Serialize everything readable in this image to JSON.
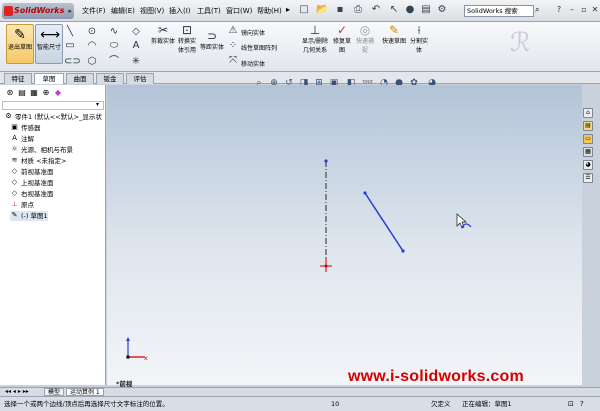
{
  "app": {
    "logo_text": "SolidWorks"
  },
  "menu": [
    {
      "label": "文件(F)"
    },
    {
      "label": "编辑(E)"
    },
    {
      "label": "视图(V)"
    },
    {
      "label": "插入(I)"
    },
    {
      "label": "工具(T)"
    },
    {
      "label": "窗口(W)"
    },
    {
      "label": "帮助(H)"
    }
  ],
  "search": {
    "placeholder": "SolidWorks 搜索"
  },
  "commands": {
    "exit_sketch": "退出草图",
    "smart_dimension": "智能尺寸",
    "trim": "剪裁实体",
    "convert": "转换实体引用",
    "offset": "等距实体",
    "mirror": "镜向实体",
    "linear_pattern": "线性草图阵列",
    "move": "移动实体",
    "display_relations": "显示/删除几何关系",
    "repair": "修复草图",
    "quick_snaps": "快速捕捉",
    "rapid_sketch": "快速草图",
    "instant2d": "分割实体"
  },
  "tabs": [
    {
      "label": "特征"
    },
    {
      "label": "草图"
    },
    {
      "label": "曲面"
    },
    {
      "label": "钣金"
    },
    {
      "label": "评估"
    }
  ],
  "feature_tree": [
    {
      "icon": "part-icon",
      "label": "零件1 (默认<<默认>_显示状"
    },
    {
      "icon": "sensor-icon",
      "label": "传感器"
    },
    {
      "icon": "annotation-icon",
      "label": "注解"
    },
    {
      "icon": "lights-icon",
      "label": "光源、相机与布景"
    },
    {
      "icon": "material-icon",
      "label": "材质 <未指定>"
    },
    {
      "icon": "plane-icon",
      "label": "前视基准面"
    },
    {
      "icon": "plane-icon",
      "label": "上视基准面"
    },
    {
      "icon": "plane-icon",
      "label": "右视基准面"
    },
    {
      "icon": "origin-icon",
      "label": "原点"
    },
    {
      "icon": "sketch-icon",
      "label": "(-) 草图1"
    }
  ],
  "view_label": "*前视",
  "watermark": "www.i-solidworks.com",
  "bottom_tabs": [
    {
      "label": "模型"
    },
    {
      "label": "运动算例 1"
    }
  ],
  "status": {
    "hint": "选择一个或两个边线/顶点后再选择尺寸文字标注的位置。",
    "value": "10",
    "state": "欠定义",
    "editing": "正在编辑：草图1"
  },
  "colors": {
    "sketch_line": "#2a3fd0",
    "centerline": "#2b2b2b",
    "accent_red": "#d40000"
  }
}
